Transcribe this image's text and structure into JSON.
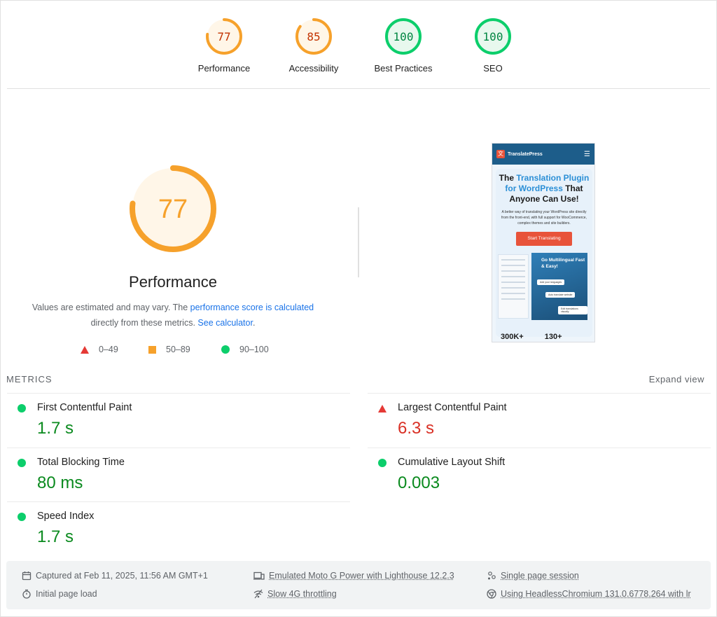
{
  "gauges": [
    {
      "label": "Performance",
      "score": "77",
      "score_value": 77,
      "color": "#f6a12b",
      "fill": "#fff6e8",
      "text_color": "#c33300"
    },
    {
      "label": "Accessibility",
      "score": "85",
      "score_value": 85,
      "color": "#f6a12b",
      "fill": "#fff6e8",
      "text_color": "#c33300"
    },
    {
      "label": "Best Practices",
      "score": "100",
      "score_value": 100,
      "color": "#0cce6b",
      "fill": "#e8f8ee",
      "text_color": "#018642"
    },
    {
      "label": "SEO",
      "score": "100",
      "score_value": 100,
      "color": "#0cce6b",
      "fill": "#e8f8ee",
      "text_color": "#018642"
    }
  ],
  "performance": {
    "score": "77",
    "score_value": 77,
    "title": "Performance",
    "desc_prefix": "Values are estimated and may vary. The ",
    "desc_link1": "performance score is calculated",
    "desc_middle": " directly from these metrics. ",
    "desc_link2": "See calculator",
    "desc_suffix": ".",
    "legend": [
      "0–49",
      "50–89",
      "90–100"
    ]
  },
  "screenshot": {
    "brand": "TranslatePress",
    "heading_pre": "The ",
    "heading_hl": "Translation Plugin for WordPress",
    "heading_post": " That Anyone Can Use!",
    "para": "A better way of translating your WordPress site directly from the front-end, with full support for WooCommerce, complex themes and site builders.",
    "button": "Start Translating",
    "blue_title": "Go Multilingual Fast & Easy!",
    "pill1": "Add your languages",
    "pill2": "Auto translate website",
    "pill3": "Edit translations visually",
    "stat1": "300K+",
    "stat2": "130+"
  },
  "metrics": {
    "header": "METRICS",
    "expand": "Expand view",
    "items": [
      {
        "name": "First Contentful Paint",
        "value": "1.7 s",
        "status": "pass"
      },
      {
        "name": "Largest Contentful Paint",
        "value": "6.3 s",
        "status": "fail"
      },
      {
        "name": "Total Blocking Time",
        "value": "80 ms",
        "status": "pass"
      },
      {
        "name": "Cumulative Layout Shift",
        "value": "0.003",
        "status": "pass"
      },
      {
        "name": "Speed Index",
        "value": "1.7 s",
        "status": "pass"
      }
    ]
  },
  "footer": {
    "captured": "Captured at Feb 11, 2025, 11:56 AM GMT+1",
    "initial_load": "Initial page load",
    "emulated": "Emulated Moto G Power with Lighthouse 12.2.3",
    "throttling": "Slow 4G throttling",
    "session": "Single page session",
    "browser": "Using HeadlessChromium 131.0.6778.264 with lr"
  },
  "colors": {
    "pass": "#0a8a1e",
    "fail": "#d93025",
    "average": "#f6a12b",
    "link": "#1a73e8"
  }
}
